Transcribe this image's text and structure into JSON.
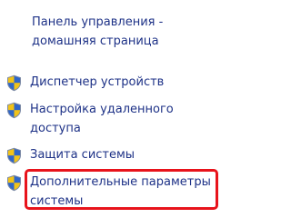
{
  "tasks_panel": {
    "home_link": "Панель управления - домашняя страница",
    "items": [
      {
        "label": "Диспетчер устройств",
        "icon": "uac-shield-icon"
      },
      {
        "label": "Настройка удаленного доступа",
        "icon": "uac-shield-icon"
      },
      {
        "label": "Защита системы",
        "icon": "uac-shield-icon"
      },
      {
        "label": "Дополнительные параметры системы",
        "icon": "uac-shield-icon",
        "highlighted": true
      }
    ]
  },
  "colors": {
    "link_text": "#1e3287",
    "highlight_border": "#e8131b",
    "shield_blue": "#2f66c9",
    "shield_yellow": "#f2c318"
  }
}
